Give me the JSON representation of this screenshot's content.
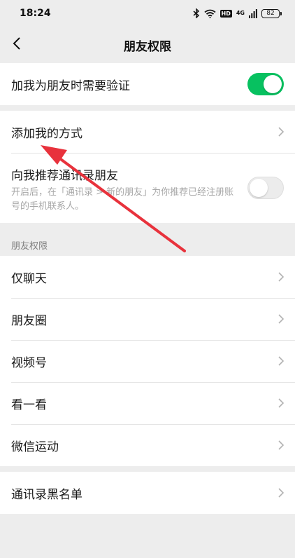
{
  "status_bar": {
    "time": "18:24",
    "hd": "HD",
    "network": "4G",
    "battery": "82"
  },
  "nav": {
    "title": "朋友权限"
  },
  "verify_group": {
    "verify_label": "加我为朋友时需要验证",
    "verify_enabled": true
  },
  "add_group": {
    "add_methods_label": "添加我的方式",
    "recommend_label": "向我推荐通讯录朋友",
    "recommend_desc": "开启后，在「通讯录 > 新的朋友」为你推荐已经注册账号的手机联系人。",
    "recommend_enabled": false
  },
  "permissions": {
    "header": "朋友权限",
    "items": [
      {
        "label": "仅聊天"
      },
      {
        "label": "朋友圈"
      },
      {
        "label": "视频号"
      },
      {
        "label": "看一看"
      },
      {
        "label": "微信运动"
      }
    ]
  },
  "blacklist": {
    "label": "通讯录黑名单"
  },
  "colors": {
    "accent": "#07c160",
    "annotation_arrow": "#e8323c"
  }
}
